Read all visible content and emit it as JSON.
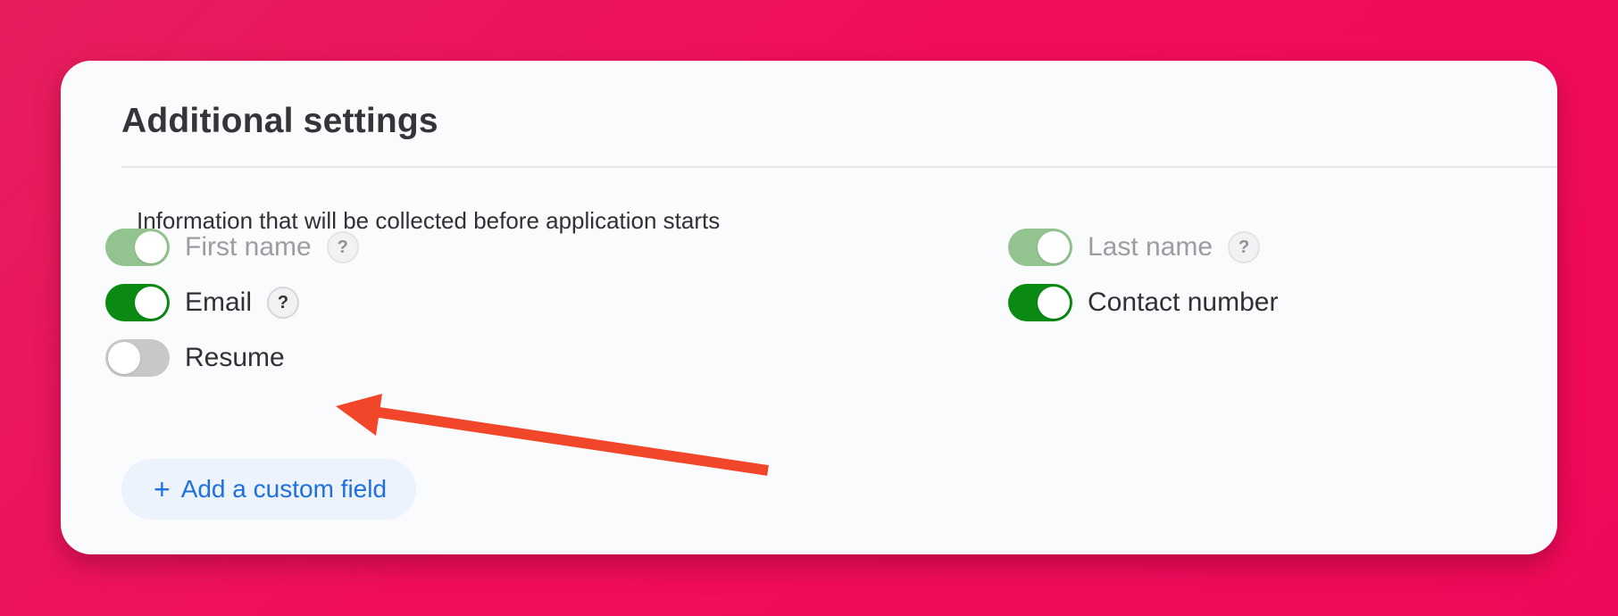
{
  "panel": {
    "title": "Additional settings",
    "description": "Information that will be collected before application starts"
  },
  "fields": {
    "first_name": {
      "label": "First name",
      "enabled": true,
      "locked": true,
      "help": "?"
    },
    "last_name": {
      "label": "Last name",
      "enabled": true,
      "locked": true,
      "help": "?"
    },
    "email": {
      "label": "Email",
      "enabled": true,
      "locked": false,
      "help": "?"
    },
    "contact_number": {
      "label": "Contact number",
      "enabled": true,
      "locked": false
    },
    "resume": {
      "label": "Resume",
      "enabled": false,
      "locked": false
    }
  },
  "actions": {
    "add_custom_field_icon": "plus-icon",
    "add_custom_field_label": "Add a custom field"
  },
  "colors": {
    "background": "#f20d5b",
    "toggle_on": "#0a8a12",
    "toggle_on_locked": "#93c48f",
    "toggle_off": "#c8c8ca",
    "link": "#1f6fde",
    "annotation_arrow": "#f2462a"
  },
  "annotation": {
    "icon": "arrow-annotation",
    "points_to": "Resume"
  }
}
